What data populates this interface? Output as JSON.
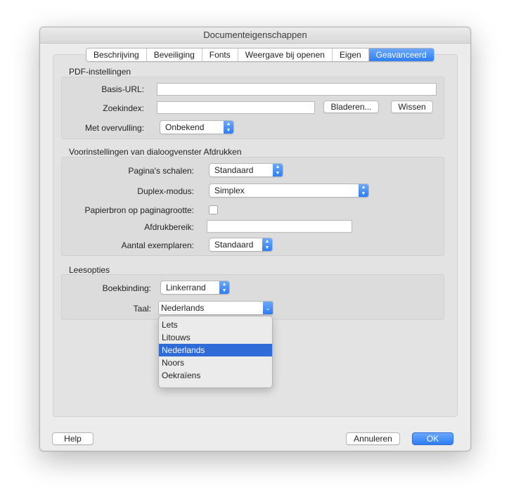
{
  "window": {
    "title": "Documenteigenschappen"
  },
  "tabs": [
    {
      "label": "Beschrijving",
      "active": false
    },
    {
      "label": "Beveiliging",
      "active": false
    },
    {
      "label": "Fonts",
      "active": false
    },
    {
      "label": "Weergave bij openen",
      "active": false
    },
    {
      "label": "Eigen",
      "active": false
    },
    {
      "label": "Geavanceerd",
      "active": true
    }
  ],
  "pdf": {
    "title": "PDF-instellingen",
    "base_url_label": "Basis-URL:",
    "base_url_value": "",
    "search_index_label": "Zoekindex:",
    "search_index_value": "",
    "browse_label": "Bladeren...",
    "clear_label": "Wissen",
    "trapping_label": "Met overvulling:",
    "trapping_value": "Onbekend"
  },
  "print": {
    "title": "Voorinstellingen van dialoogvenster Afdrukken",
    "scaling_label": "Pagina's schalen:",
    "scaling_value": "Standaard",
    "duplex_label": "Duplex-modus:",
    "duplex_value": "Simplex",
    "paper_source_label": "Papierbron op paginagrootte:",
    "paper_source_checked": false,
    "print_range_label": "Afdrukbereik:",
    "print_range_value": "",
    "copies_label": "Aantal exemplaren:",
    "copies_value": "Standaard"
  },
  "reading": {
    "title": "Leesopties",
    "binding_label": "Boekbinding:",
    "binding_value": "Linkerrand",
    "language_label": "Taal:",
    "language_value": "Nederlands",
    "language_options": [
      "Lets",
      "Litouws",
      "Nederlands",
      "Noors",
      "Oekraïens"
    ],
    "language_selected_index": 2
  },
  "footer": {
    "help_label": "Help",
    "cancel_label": "Annuleren",
    "ok_label": "OK"
  },
  "colors": {
    "accent": "#2f7ef5",
    "selection": "#2f6cd8",
    "window_bg": "#ececec"
  }
}
